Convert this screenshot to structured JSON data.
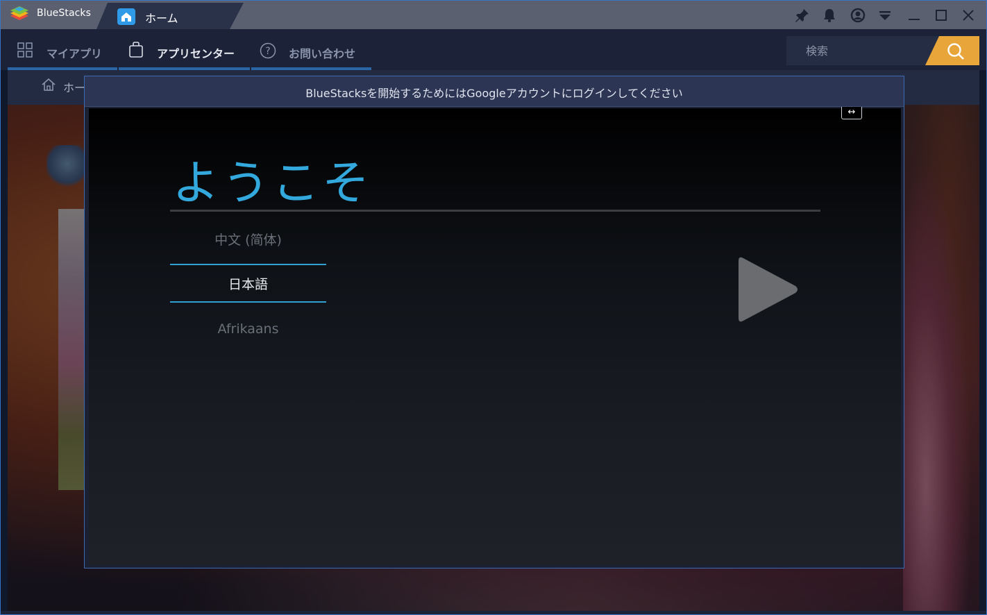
{
  "titlebar": {
    "app_name": "BlueStacks",
    "home_tab_label": "ホーム",
    "icons": [
      "pin-icon",
      "bell-icon",
      "account-icon",
      "dropdown-menu-icon",
      "minimize-icon",
      "maximize-icon",
      "close-icon"
    ]
  },
  "nav": {
    "items": [
      {
        "label": "マイアプリ",
        "icon": "grid-icon",
        "active": false
      },
      {
        "label": "アプリセンター",
        "icon": "shopping-bag-icon",
        "active": true
      },
      {
        "label": "お問い合わせ",
        "icon": "help-icon",
        "active": false
      }
    ],
    "search": {
      "placeholder": "検索",
      "value": ""
    }
  },
  "breadcrumb": {
    "label": "ホー"
  },
  "dialog": {
    "title": "BlueStacksを開始するためにはGoogleアカウントにログインしてください",
    "resize_glyph": "↔",
    "welcome": "ようこそ",
    "languages": [
      {
        "label": "中文 (简体)",
        "selected": false
      },
      {
        "label": "日本語",
        "selected": true
      },
      {
        "label": "Afrikaans",
        "selected": false
      }
    ]
  },
  "colors": {
    "accent_blue": "#33a8dc",
    "search_orange": "#e8a53a",
    "titlebar": "#5b6071",
    "dialog_header": "#2d3554"
  }
}
